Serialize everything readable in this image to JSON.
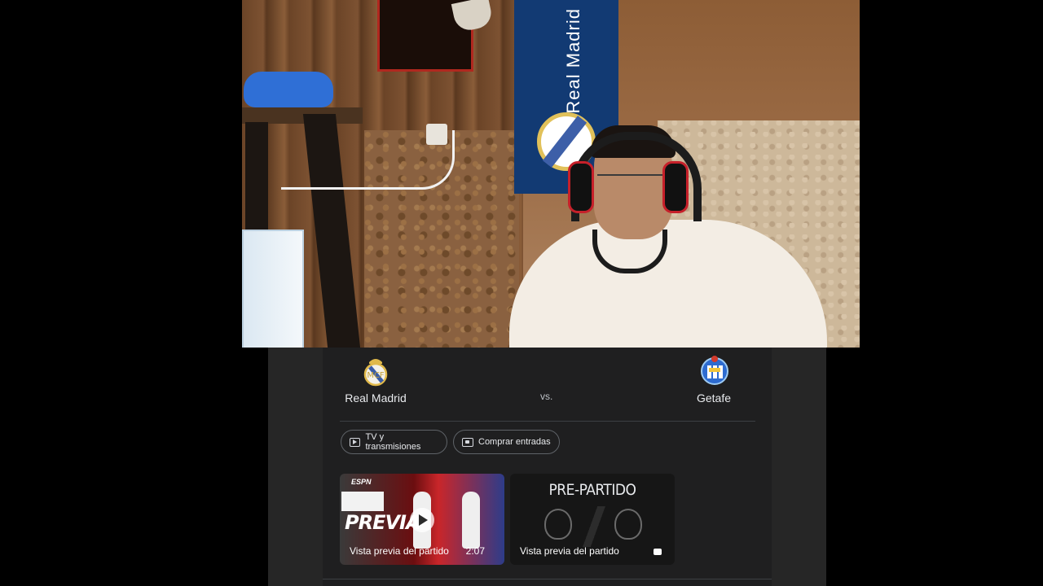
{
  "webcam": {
    "banner_text": "Real Madrid"
  },
  "match": {
    "home_team": "Real Madrid",
    "away_team": "Getafe",
    "vs_label": "vs.",
    "colors": {
      "panel_bg": "#202124",
      "card_bg": "#1f1f20",
      "text": "#e8eaed",
      "divider": "#3c4043"
    }
  },
  "actions": {
    "tv_label": "TV y transmisiones",
    "tickets_label": "Comprar entradas"
  },
  "videos": [
    {
      "brand_tag": "ESPN",
      "overlay_title": "PREVIA",
      "caption": "Vista previa del partido",
      "duration": "2:07"
    },
    {
      "overlay_title": "PRE-PARTIDO",
      "caption": "Vista previa del partido"
    }
  ]
}
